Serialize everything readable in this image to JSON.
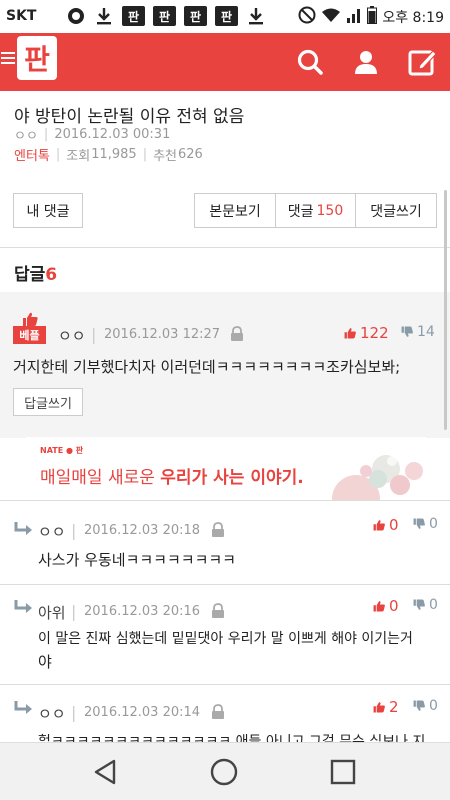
{
  "status_bar": {
    "carrier": "SKT",
    "pan_icons": [
      "판",
      "판",
      "판",
      "판"
    ],
    "time": "오후 8:19"
  },
  "header": {
    "logo": "판"
  },
  "article": {
    "title": "야 방탄이 논란될 이유 전혀 없음",
    "author": "ㅇㅇ",
    "date": "2016.12.03 00:31",
    "category": "엔터톡",
    "views_label": "조회",
    "views": "11,985",
    "recommend_label": "추천",
    "recommend": "626"
  },
  "actions": {
    "my_comments": "내 댓글",
    "view_post": "본문보기",
    "comments_label": "댓글",
    "comments_count": "150",
    "write_comment": "댓글쓰기"
  },
  "replies": {
    "label": "답글",
    "count": "6"
  },
  "best_comment": {
    "badge": "베플",
    "author": "ㅇㅇ",
    "date": "2016.12.03 12:27",
    "up": "122",
    "down": "14",
    "text": "거지한테 기부했다치자 이러던데ㅋㅋㅋㅋㅋㅋㅋㅋ조카심보봐;",
    "reply_button": "답글쓰기"
  },
  "ad": {
    "brand": "NATE ● 판",
    "text_plain": "매일매일 새로운",
    "text_bold": "우리가 사는 이야기."
  },
  "comments": [
    {
      "author": "ㅇㅇ",
      "date": "2016.12.03 20:18",
      "up": "0",
      "down": "0",
      "text": "사스가 우동네ㅋㅋㅋㅋㅋㅋㅋㅋ",
      "text2": ""
    },
    {
      "author": "아위",
      "date": "2016.12.03 20:16",
      "up": "0",
      "down": "0",
      "text": "이 말은 진짜 심했는데 밑밑댓아 우리가 말 이쁘게 해야 이기는거",
      "text2": "야"
    },
    {
      "author": "ㅇㅇ",
      "date": "2016.12.03 20:14",
      "up": "2",
      "down": "0",
      "text": "헐ㅋㅋㅋㅋㅋㅋㅋㅋㅋㅋㅋㅋㅋㅋ 애들 아니고 그걸 무슨 심보나 지",
      "text2": ""
    }
  ],
  "colors": {
    "brand": "#e8433f",
    "down": "#8a9ba8"
  }
}
